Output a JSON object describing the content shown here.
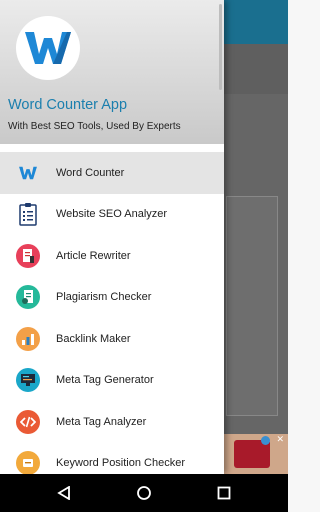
{
  "app": {
    "title": "Word Counter App",
    "subtitle": "With Best SEO Tools, Used By Experts",
    "logo_icon": "w-logo-icon",
    "accent_color": "#1b7fae"
  },
  "menu": {
    "items": [
      {
        "label": "Word Counter",
        "icon": "w-logo-icon",
        "selected": true
      },
      {
        "label": "Website SEO Analyzer",
        "icon": "clipboard-icon"
      },
      {
        "label": "Article Rewriter",
        "icon": "document-rewrite-icon"
      },
      {
        "label": "Plagiarism Checker",
        "icon": "document-check-icon"
      },
      {
        "label": "Backlink Maker",
        "icon": "bar-chart-icon"
      },
      {
        "label": "Meta Tag Generator",
        "icon": "monitor-icon"
      },
      {
        "label": "Meta Tag Analyzer",
        "icon": "code-icon"
      },
      {
        "label": "Keyword Position Checker",
        "icon": "keyword-icon"
      }
    ]
  },
  "navbar": {
    "back": "back-icon",
    "home": "home-icon",
    "recents": "recents-icon"
  }
}
